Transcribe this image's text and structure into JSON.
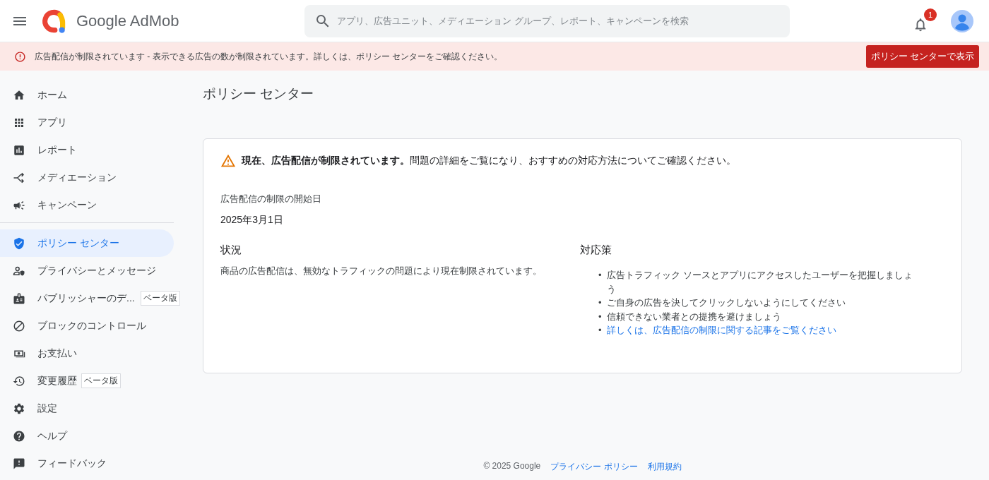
{
  "header": {
    "brand": "Google AdMob",
    "search": {
      "placeholder": "アプリ、広告ユニット、メディエーション グループ、レポート、キャンペーンを検索"
    },
    "notifications": {
      "count": "1"
    }
  },
  "alert": {
    "message": "広告配信が制限されています - 表示できる広告の数が制限されています。詳しくは、ポリシー センターをご確認ください。",
    "button": "ポリシー センターで表示"
  },
  "sidebar": {
    "groups": [
      [
        {
          "label": "ホーム",
          "selected": false
        },
        {
          "label": "アプリ",
          "selected": false
        },
        {
          "label": "レポート",
          "selected": false
        },
        {
          "label": "メディエーション",
          "selected": false
        },
        {
          "label": "キャンペーン",
          "selected": false
        }
      ],
      [
        {
          "label": "ポリシー センター",
          "selected": true
        },
        {
          "label": "プライバシーとメッセージ",
          "selected": false
        },
        {
          "label": "パブリッシャーのデ...",
          "selected": false,
          "badge": "ベータ版"
        },
        {
          "label": "ブロックのコントロール",
          "selected": false
        },
        {
          "label": "お支払い",
          "selected": false
        },
        {
          "label": "変更履歴",
          "selected": false,
          "badge": "ベータ版"
        },
        {
          "label": "設定",
          "selected": false
        },
        {
          "label": "ヘルプ",
          "selected": false
        },
        {
          "label": "フィードバック",
          "selected": false
        }
      ]
    ]
  },
  "page": {
    "title": "ポリシー センター",
    "card": {
      "warning": "**現在、広告配信が制限されています。**問題の詳細をご覧になり、おすすめの対応方法についてご確認ください。",
      "start_label": "広告配信の制限の開始日",
      "start_date": "2025年3月1日",
      "status": {
        "heading": "状況",
        "text": "商品の広告配信は、無効なトラフィックの問題により現在制限されています。"
      },
      "actions": {
        "heading": "対応策",
        "items": [
          {
            "kind": "text",
            "marker": "•",
            "text": "広告トラフィック ソースとアプリにアクセスしたユーザーを把握しましょう"
          },
          {
            "kind": "text",
            "marker": "•",
            "text": "ご自身の広告を決してクリックしないようにしてください"
          },
          {
            "kind": "text",
            "marker": "•",
            "text": "信頼できない業者との提携を避けましょう"
          },
          {
            "kind": "link",
            "marker": "•",
            "text": "詳しくは、広告配信の制限に関する記事をご覧ください"
          }
        ]
      }
    }
  },
  "footer": {
    "copyright": "© 2025 Google",
    "links": [
      "プライバシー ポリシー",
      "利用規約"
    ]
  }
}
